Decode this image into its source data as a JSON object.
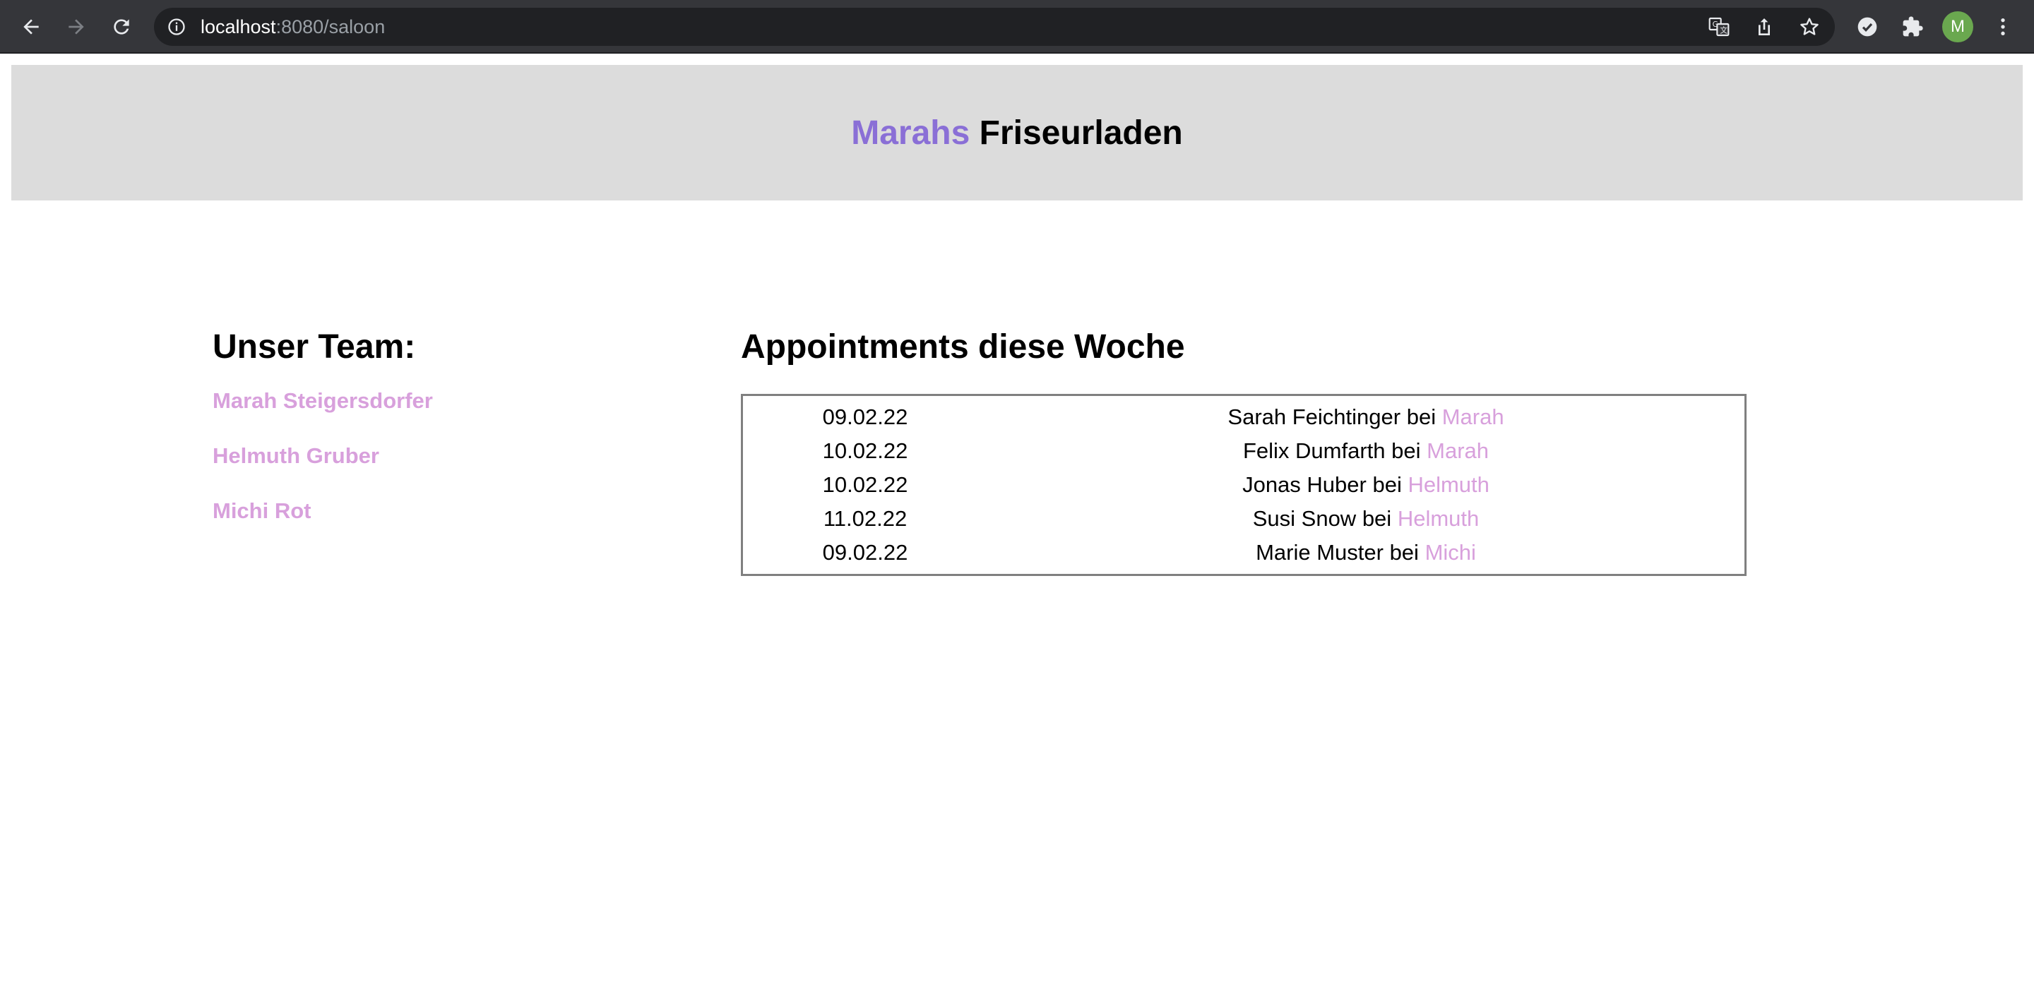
{
  "browser": {
    "url_host": "localhost",
    "url_rest": ":8080/saloon",
    "avatar_letter": "M",
    "icons": [
      "back-icon",
      "forward-icon",
      "reload-icon",
      "info-icon",
      "translate-icon",
      "share-icon",
      "star-icon",
      "extension-check-icon",
      "puzzle-icon",
      "menu-icon"
    ]
  },
  "header": {
    "brand": "Marahs",
    "title_rest": " Friseurladen",
    "brand_color": "#8a6fd6",
    "background": "#dcdcdc"
  },
  "team": {
    "heading": "Unser Team:",
    "members": [
      "Marah Steigersdorfer",
      "Helmuth Gruber",
      "Michi Rot"
    ],
    "link_color": "#d8a0dc"
  },
  "appointments": {
    "heading": "Appointments diese Woche",
    "rows": [
      {
        "date": "09.02.22",
        "client": "Sarah Feichtinger",
        "connector": " bei ",
        "stylist": "Marah"
      },
      {
        "date": "10.02.22",
        "client": "Felix Dumfarth",
        "connector": " bei ",
        "stylist": "Marah"
      },
      {
        "date": "10.02.22",
        "client": "Jonas Huber",
        "connector": " bei ",
        "stylist": "Helmuth"
      },
      {
        "date": "11.02.22",
        "client": "Susi Snow",
        "connector": " bei ",
        "stylist": "Helmuth"
      },
      {
        "date": "09.02.22",
        "client": "Marie Muster",
        "connector": " bei ",
        "stylist": "Michi"
      }
    ]
  }
}
